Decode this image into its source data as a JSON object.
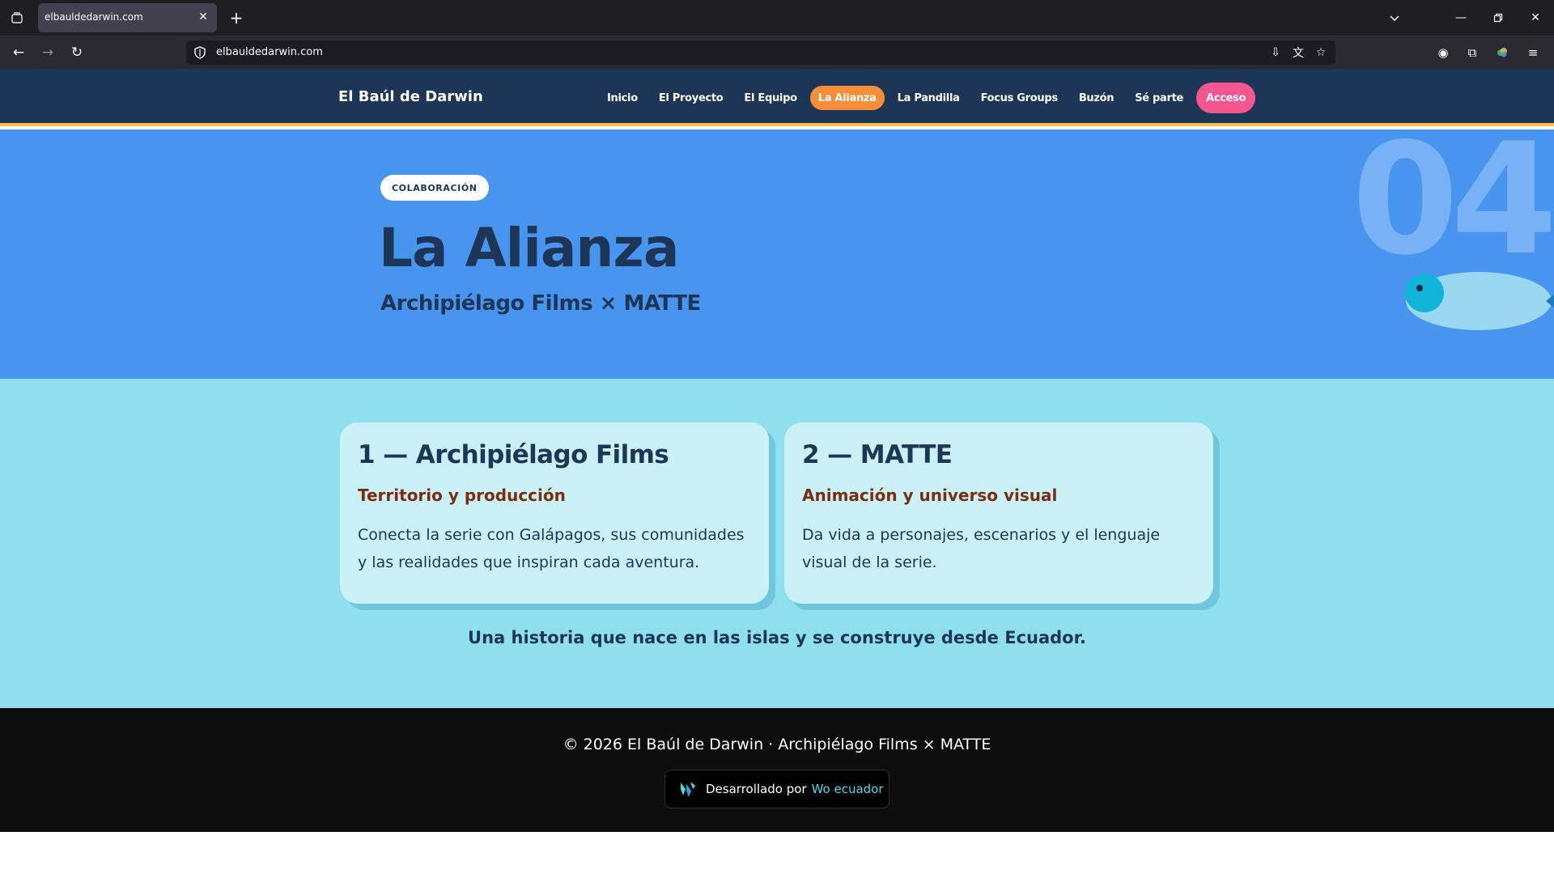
{
  "browser": {
    "tab_title": "elbauldedarwin.com",
    "url": "elbauldedarwin.com"
  },
  "header": {
    "brand": "El Baúl de Darwin",
    "nav": [
      {
        "label": "Inicio"
      },
      {
        "label": "El Proyecto"
      },
      {
        "label": "El Equipo"
      },
      {
        "label": "La Alianza",
        "active": true
      },
      {
        "label": "La Pandilla"
      },
      {
        "label": "Focus Groups"
      },
      {
        "label": "Buzón"
      },
      {
        "label": "Sé parte"
      },
      {
        "label": "Acceso",
        "cta": true
      }
    ]
  },
  "hero": {
    "badge": "COLABORACIÓN",
    "title": "La Alianza",
    "subtitle": "Archipiélago Films × MATTE",
    "section_number": "04"
  },
  "partners": {
    "cards": [
      {
        "title": "1 — Archipiélago Films",
        "role": "Territorio y producción",
        "description": "Conecta la serie con Galápagos, sus comunidades y las realidades que inspiran cada aventura."
      },
      {
        "title": "2 — MATTE",
        "role": "Animación y universo visual",
        "description": "Da vida a personajes, escenarios y el lenguaje visual de la serie."
      }
    ],
    "tagline": "Una historia que nace en las islas y se construye desde Ecuador."
  },
  "footer": {
    "copyright": "© 2026 El Baúl de Darwin · Archipiélago Films × MATTE",
    "credit_text": "Desarrollado por",
    "credit_link": "Wo ecuador"
  },
  "colors": {
    "header_bg": "#1d3557",
    "header_border": "#f4c14f",
    "active_nav": "#f88e3a",
    "cta": "#f4578e",
    "hero_bg": "#4895ef",
    "partners_bg": "#90dfef",
    "card_bg": "#caf0f8",
    "role_text": "#7a2e10",
    "footer_bg": "#0d0d0d"
  }
}
